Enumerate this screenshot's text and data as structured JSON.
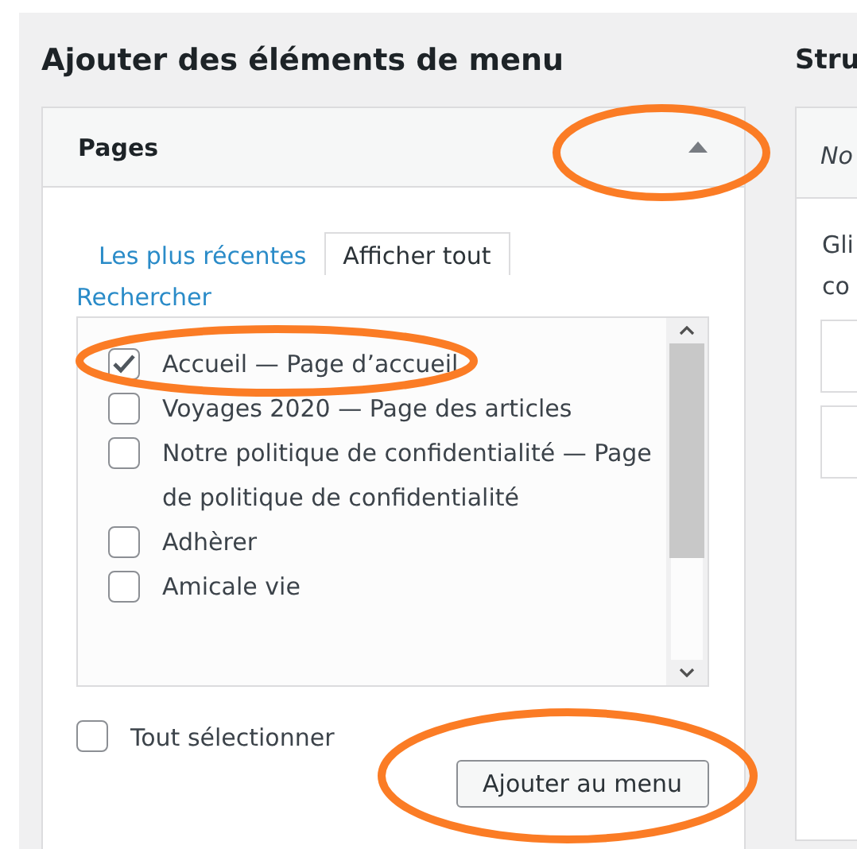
{
  "add_items": {
    "title": "Ajouter des éléments de menu",
    "panel": {
      "title": "Pages",
      "expanded": true,
      "tabs": [
        {
          "label": "Les plus récentes",
          "selected": false
        },
        {
          "label": "Afficher tout",
          "selected": true
        },
        {
          "label": "Rechercher",
          "selected": false
        }
      ],
      "pages": [
        {
          "label": "Accueil — Page d’accueil",
          "checked": true
        },
        {
          "label": "Voyages 2020 — Page des articles",
          "checked": false
        },
        {
          "label": "Notre politique de confidentialité — Page de politique de confidentialité",
          "checked": false
        },
        {
          "label": "Adhèrer",
          "checked": false
        },
        {
          "label": "Amicale vie",
          "checked": false
        }
      ],
      "select_all": {
        "label": "Tout sélectionner",
        "checked": false
      },
      "button": "Ajouter au menu"
    }
  },
  "structure": {
    "title": "Stru",
    "panel_header": "No",
    "text_lines": [
      "Gli",
      "co"
    ]
  }
}
